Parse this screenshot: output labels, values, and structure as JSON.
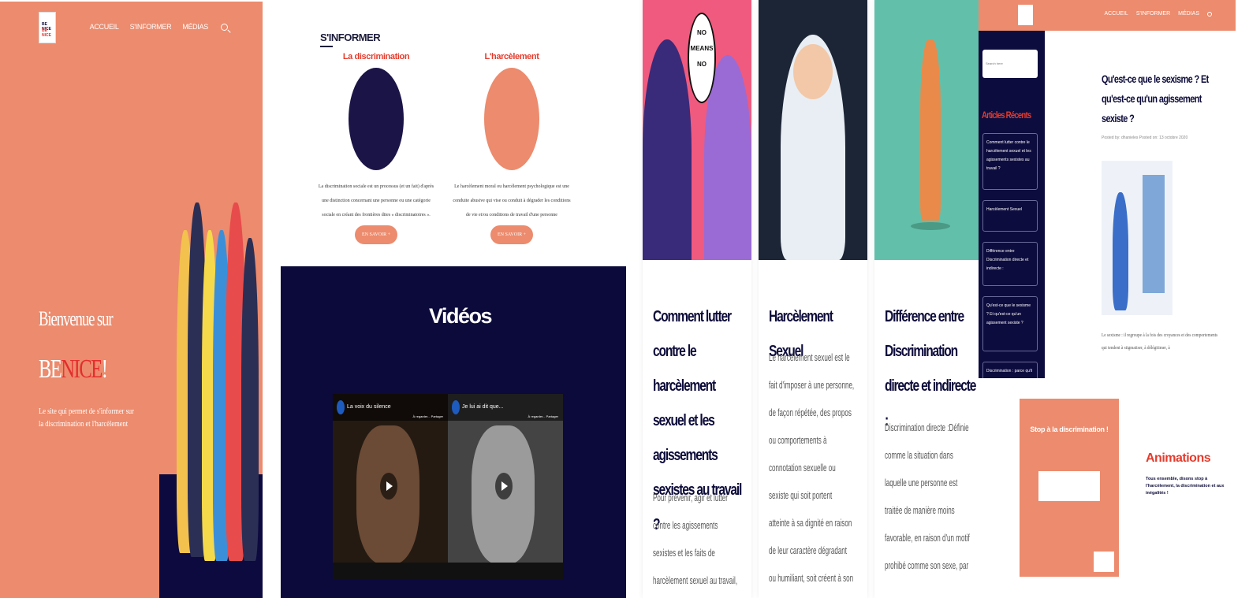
{
  "home": {
    "nav": [
      "ACCUEIL",
      "S'INFORMER",
      "MÉDIAS"
    ],
    "welcome": "Bienvenue sur",
    "brand_a": "BE",
    "brand_b": "NICE",
    "brand_c": "!",
    "subtitle": "Le site qui permet de s'informer sur la discrimination et l'harcèlement",
    "logo_line1": "BE NICE",
    "logo_line2": "BE NICE"
  },
  "informer": {
    "title": "S'INFORMER",
    "cards": [
      {
        "title": "La discrimination",
        "text": "La discrimination sociale est un processus (et un fait) d'après une distinction concernant une personne ou une catégorie sociale en créant des frontières dites « discriminatoires ».",
        "button": "EN SAVOIR +"
      },
      {
        "title": "L'harcèlement",
        "text": "Le harcèlement moral ou harcèlement psychologique est une conduite abusive qui vise ou conduit à dégrader les conditions de vie et/ou conditions de travail d'une personne",
        "button": "EN SAVOIR +"
      }
    ]
  },
  "videos": {
    "title": "Vidéos",
    "items": [
      {
        "title": "La voix du silence",
        "meta": "À regarder...   Partager"
      },
      {
        "title": "Je lui ai dit que...",
        "meta": "À regarder...   Partager"
      }
    ]
  },
  "articles": [
    {
      "title": "Comment lutter contre le harcèlement sexuel et les agissements sexistes au travail ?",
      "body": "Pour prévenir, agir et lutter contre les agissements sexistes et les faits de harcèlement sexuel au travail, la Loi pour la"
    },
    {
      "title": "Harcèlement Sexuel",
      "body": "Le harcèlement sexuel est le fait d'imposer à une personne, de façon répétée, des propos ou comportements à connotation sexuelle ou sexiste qui soit portent atteinte à sa dignité en raison de leur caractère dégradant ou humiliant, soit créent à son encontre une"
    },
    {
      "title": "Différence entre Discrimination directe et indirecte :",
      "body": "Discrimination directe :Définie comme la situation dans laquelle une personne est traitée de manière moins favorable, en raison d'un motif prohibé comme son sexe, par"
    }
  ],
  "bubble": [
    "NO",
    "MEANS",
    "NO"
  ],
  "sexism_page": {
    "nav": [
      "ACCUEIL",
      "S'INFORMER",
      "MÉDIAS"
    ],
    "search_placeholder": "Search here",
    "recent_title": "Articles Récents",
    "recent_items": [
      "Comment lutter contre le harcèlement sexuel et les agissements sexistes au travail ?",
      "Harcèlement Sexuel",
      "Différence entre Discrimination directe et indirecte :",
      "Qu'est-ce que le sexisme ? Et qu'est-ce qu'un agissement sexiste ?",
      "Discrimination : parce qu'il"
    ],
    "title": "Qu'est-ce que le sexisme ? Et qu'est-ce qu'un agissement sexiste ?",
    "meta": "Posted by: dhanieles  Posted on: 13 octobre 2020",
    "text": "Le sexisme : il regroupe à la fois des croyances et des comportements qui tendent à stigmatiser, à délégitimer, à"
  },
  "animations": {
    "card_title": "Stop à la discrimination !",
    "title": "Animations",
    "subtitle": "Tous ensemble, disons stop à l'harcèlement, la discrimination et aux inégalités !"
  },
  "colors": {
    "coral": "#ec8b6d",
    "navy": "#0d0c3a",
    "red": "#e63b2c"
  }
}
